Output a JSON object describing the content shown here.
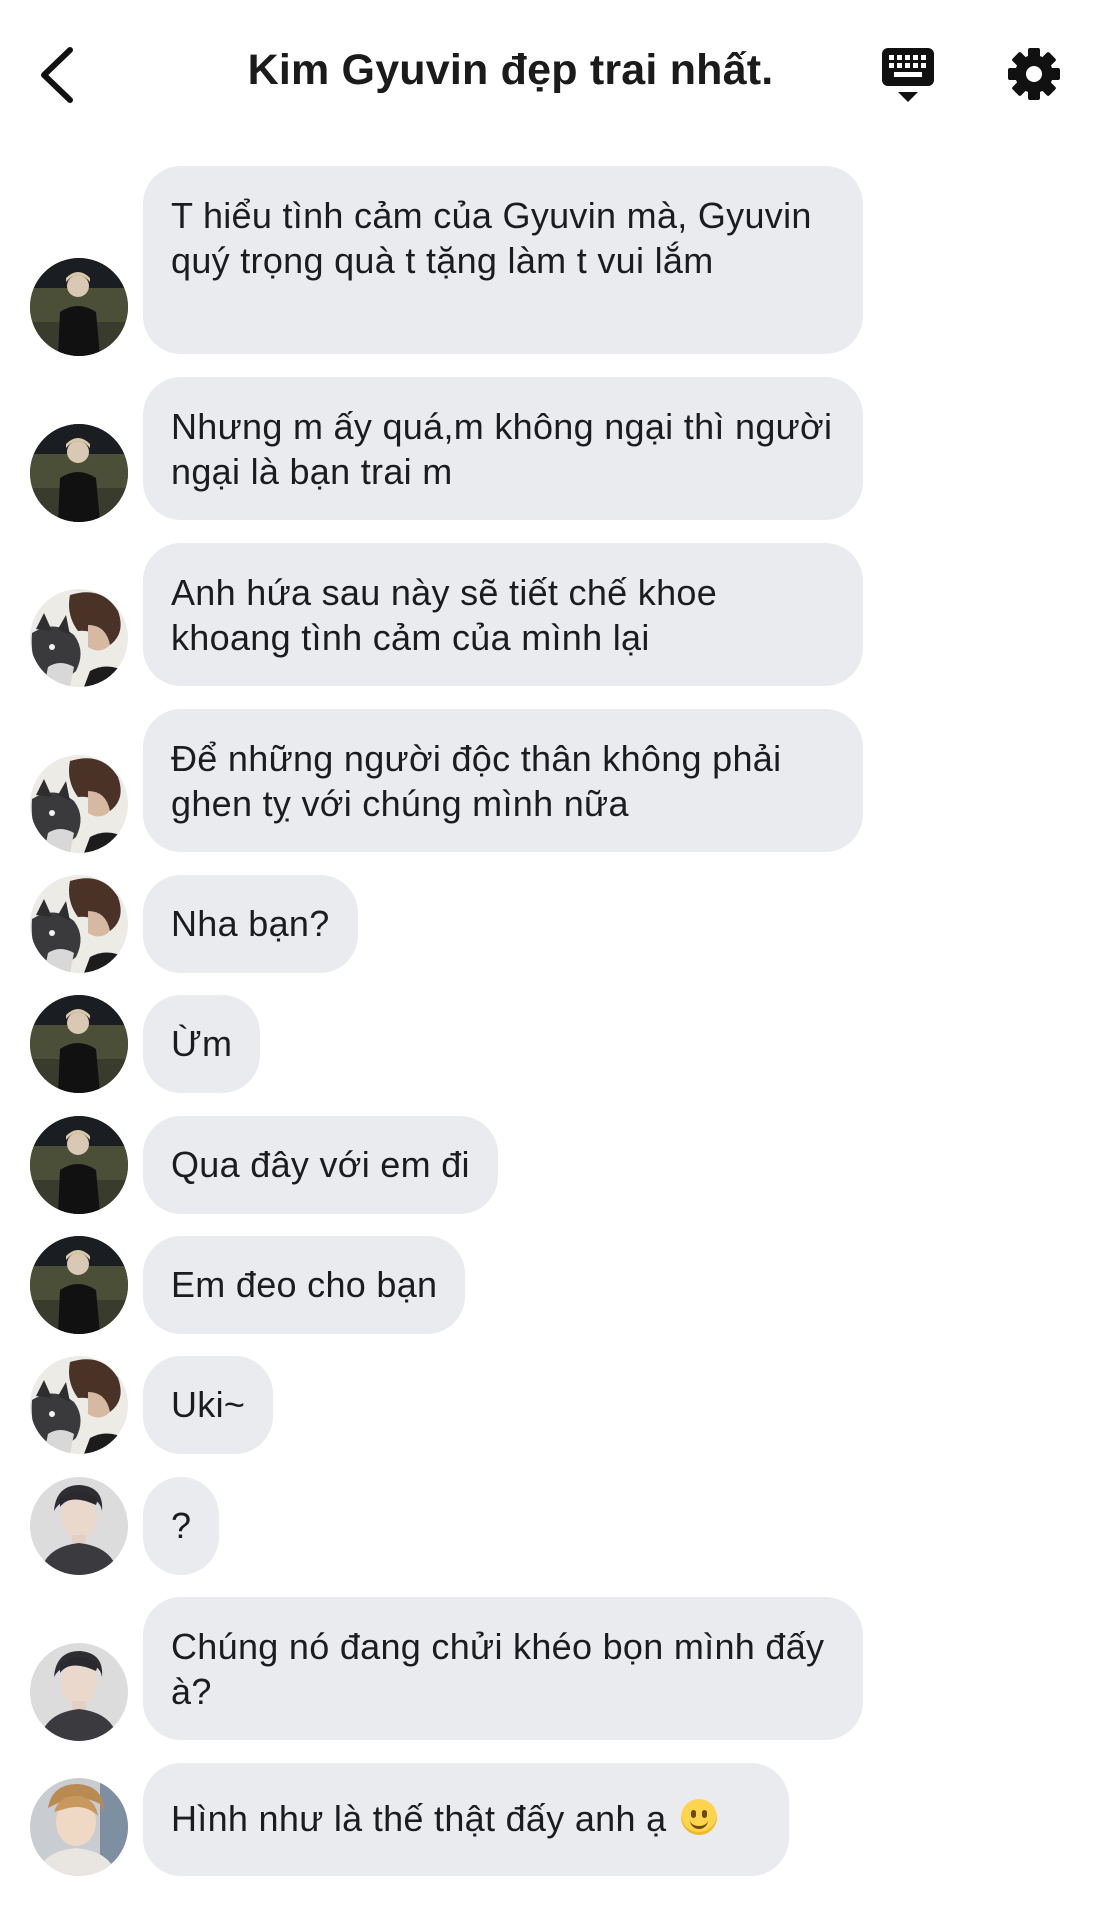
{
  "header": {
    "title": "Kim Gyuvin đẹp trai nhất.",
    "back_icon": "chevron-left-icon",
    "keyboard_icon": "keyboard-icon",
    "settings_icon": "gear-icon"
  },
  "colors": {
    "bubble": "#e9ebef",
    "text": "#1c1c1e",
    "background": "#ffffff"
  },
  "messages": [
    {
      "sender": "a",
      "text": "T hiểu tình cảm của Gyuvin mà, Gyuvin quý trọng quà t tặng làm t vui lắm"
    },
    {
      "sender": "a",
      "text": "Nhưng m ấy quá,m không ngại thì người ngại là bạn trai m"
    },
    {
      "sender": "b",
      "text": "Anh hứa sau này sẽ tiết chế khoe khoang tình cảm của mình lại"
    },
    {
      "sender": "b",
      "text": "Để những người độc thân không phải ghen tỵ với chúng mình nữa"
    },
    {
      "sender": "b",
      "text": "Nha bạn?"
    },
    {
      "sender": "a",
      "text": "Ừm"
    },
    {
      "sender": "a",
      "text": "Qua đây với em đi"
    },
    {
      "sender": "a",
      "text": "Em đeo cho bạn"
    },
    {
      "sender": "b",
      "text": "Uki~"
    },
    {
      "sender": "c",
      "text": "?"
    },
    {
      "sender": "c",
      "text": "Chúng nó đang chửi khéo bọn mình đấy à?"
    },
    {
      "sender": "d",
      "text": "Hình như là thế thật đấy anh ạ",
      "emoji": "slightly-smiling-face-icon"
    }
  ]
}
